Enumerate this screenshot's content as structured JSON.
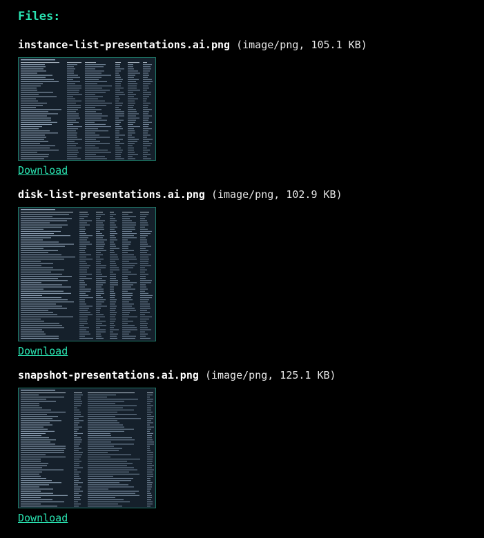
{
  "heading": "Files:",
  "files": [
    {
      "name": "instance-list-presentations.ai.png",
      "meta": "(image/png, 105.1 KB)",
      "download_label": "Download",
      "thumbnail_alt": "terminal table screenshot"
    },
    {
      "name": "disk-list-presentations.ai.png",
      "meta": "(image/png, 102.9 KB)",
      "download_label": "Download",
      "thumbnail_alt": "terminal table screenshot"
    },
    {
      "name": "snapshot-presentations.ai.png",
      "meta": "(image/png, 125.1 KB)",
      "download_label": "Download",
      "thumbnail_alt": "terminal table screenshot"
    }
  ],
  "colors": {
    "background": "#000000",
    "accent": "#29e3b1",
    "thumbnail_bg": "#15202b",
    "thumbnail_border": "#1f7a6a"
  }
}
